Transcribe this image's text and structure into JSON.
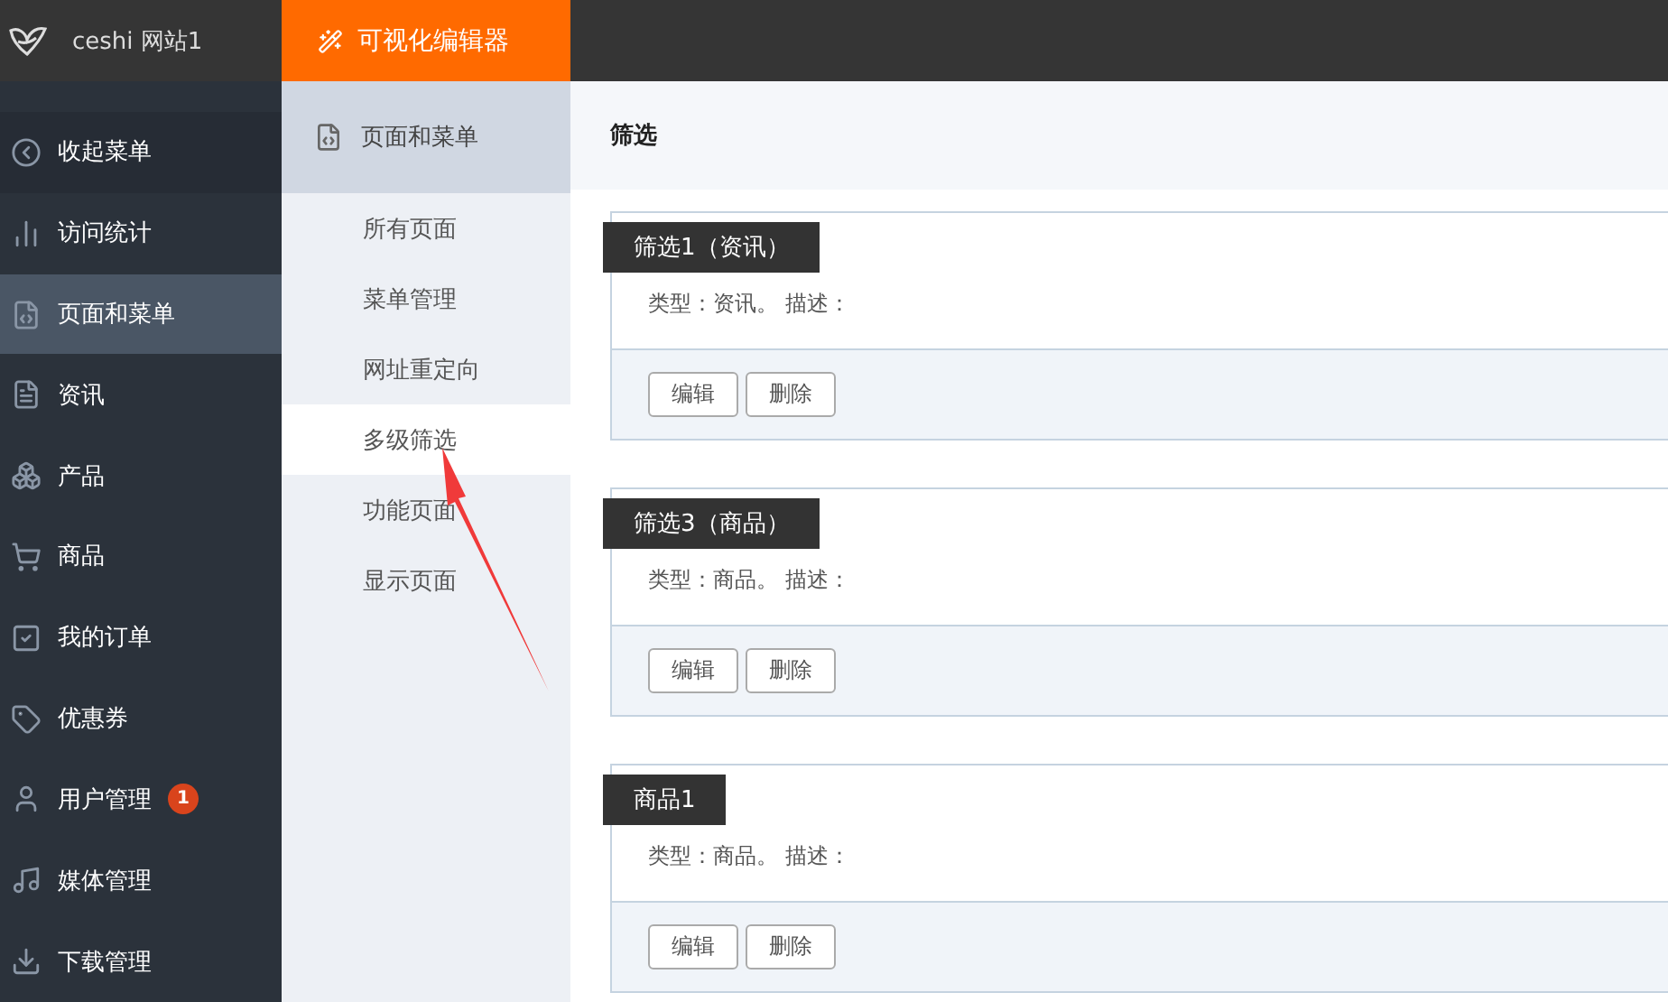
{
  "header": {
    "site": "ceshi 网站1",
    "editor_button": "可视化编辑器"
  },
  "sidebar": {
    "items": [
      {
        "kind": "collapse",
        "label": "收起菜单",
        "selected": false
      },
      {
        "kind": "stats",
        "label": "访问统计",
        "selected": false
      },
      {
        "kind": "pages",
        "label": "页面和菜单",
        "selected": true
      },
      {
        "kind": "news",
        "label": "资讯",
        "selected": false
      },
      {
        "kind": "products",
        "label": "产品",
        "selected": false
      },
      {
        "kind": "goods",
        "label": "商品",
        "selected": false
      },
      {
        "kind": "orders",
        "label": "我的订单",
        "selected": false
      },
      {
        "kind": "coupons",
        "label": "优惠券",
        "selected": false
      },
      {
        "kind": "users",
        "label": "用户管理",
        "selected": false,
        "badge": "1"
      },
      {
        "kind": "media",
        "label": "媒体管理",
        "selected": false
      },
      {
        "kind": "downloads",
        "label": "下载管理",
        "selected": false
      }
    ]
  },
  "subnav": {
    "title": "页面和菜单",
    "items": [
      {
        "label": "所有页面",
        "selected": false
      },
      {
        "label": "菜单管理",
        "selected": false
      },
      {
        "label": "网址重定向",
        "selected": false
      },
      {
        "label": "多级筛选",
        "selected": true
      },
      {
        "label": "功能页面",
        "selected": false
      },
      {
        "label": "显示页面",
        "selected": false
      }
    ]
  },
  "main": {
    "title": "筛选",
    "cards": [
      {
        "title": "筛选1（资讯）",
        "description": "类型：资讯。 描述：",
        "buttons": [
          "编辑",
          "删除"
        ]
      },
      {
        "title": "筛选3（商品）",
        "description": "类型：商品。 描述：",
        "buttons": [
          "编辑",
          "删除"
        ]
      },
      {
        "title": "商品1",
        "description": "类型：商品。 描述：",
        "buttons": [
          "编辑",
          "删除"
        ]
      }
    ]
  }
}
